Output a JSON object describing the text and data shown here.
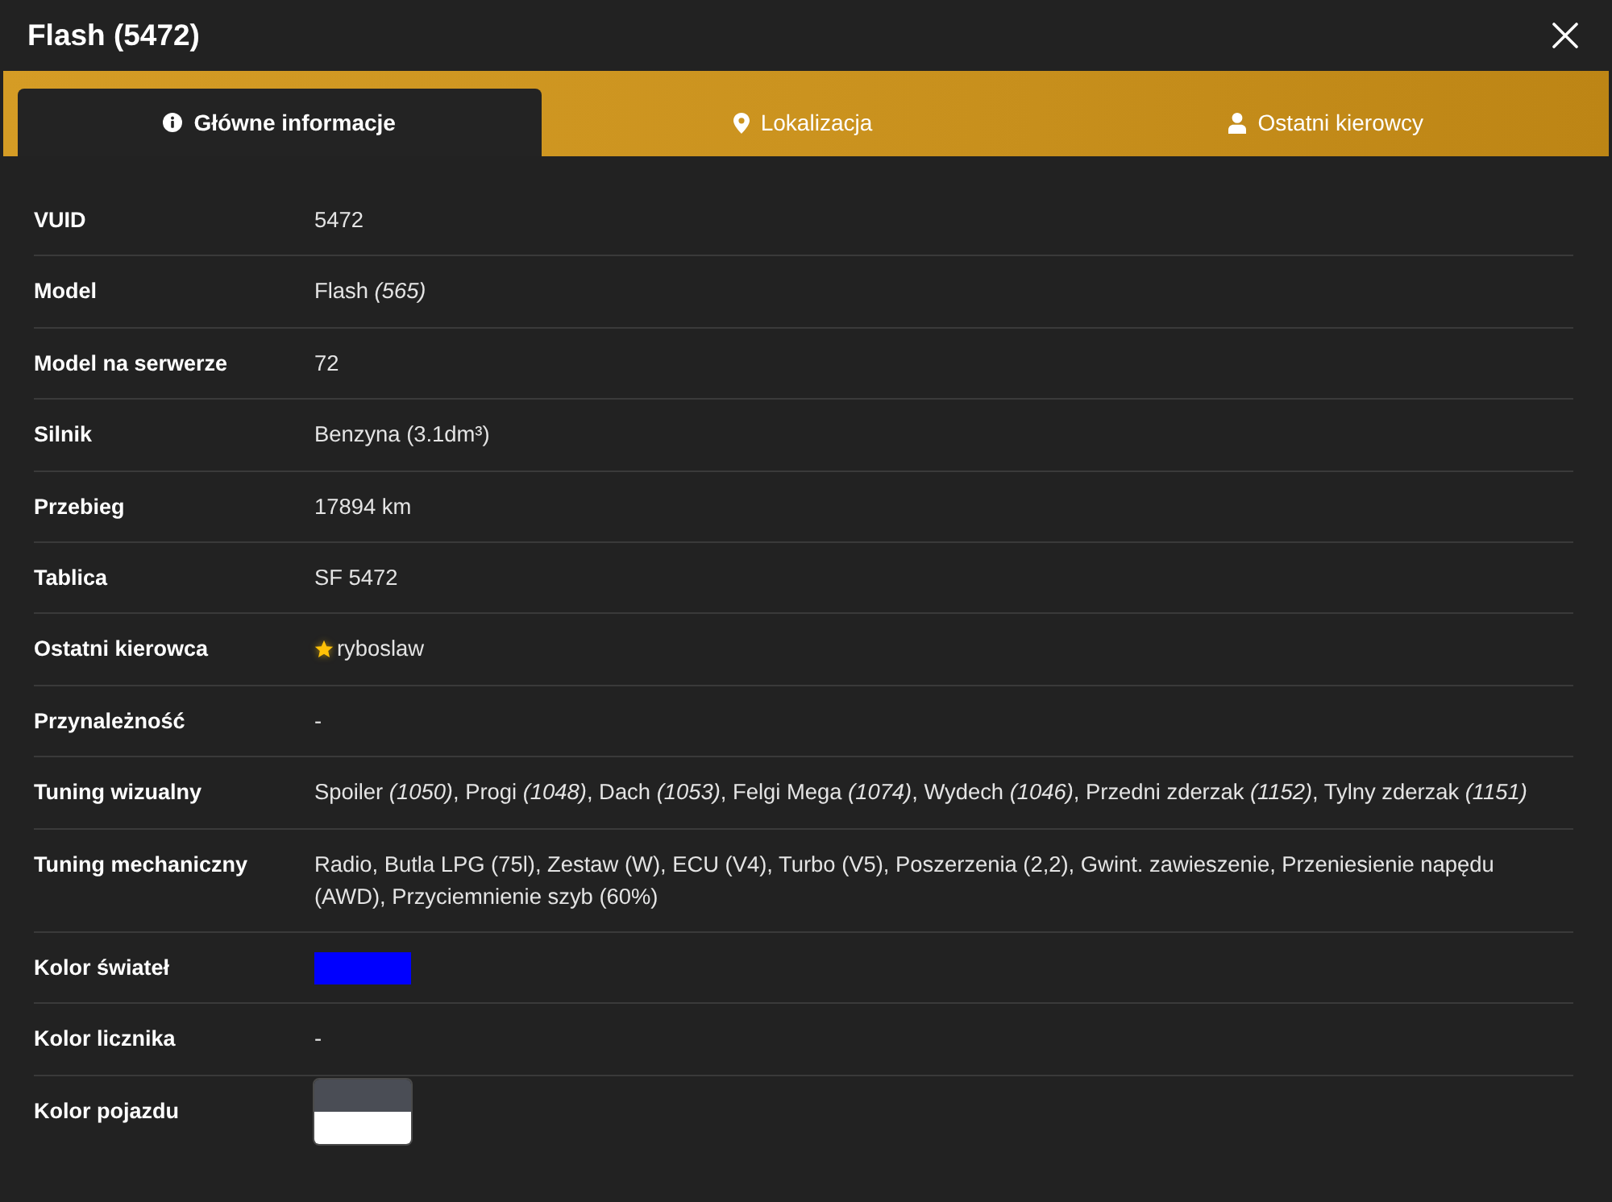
{
  "window": {
    "title": "Flash (5472)"
  },
  "tabs": [
    {
      "label": "Główne informacje",
      "kind": "info",
      "selected": true
    },
    {
      "label": "Lokalizacja",
      "kind": "location",
      "selected": false
    },
    {
      "label": "Ostatni kierowcy",
      "kind": "person",
      "selected": false
    }
  ],
  "rows": [
    {
      "label": "VUID",
      "kind": "text",
      "value": "5472"
    },
    {
      "label": "Model",
      "kind": "text",
      "value": "Flash *(565)*"
    },
    {
      "label": "Model na serwerze",
      "kind": "text",
      "value": "72"
    },
    {
      "label": "Silnik",
      "kind": "text",
      "value": "Benzyna (3.1dm³)"
    },
    {
      "label": "Przebieg",
      "kind": "text",
      "value": "17894 km"
    },
    {
      "label": "Tablica",
      "kind": "text",
      "value": "SF 5472"
    },
    {
      "label": "Ostatni kierowca",
      "kind": "player",
      "value": "ryboslaw"
    },
    {
      "label": "Przynależność",
      "kind": "text",
      "value": "-"
    },
    {
      "label": "Tuning wizualny",
      "kind": "text",
      "value": "Spoiler *(1050)*, Progi *(1048)*, Dach *(1053)*, Felgi Mega *(1074)*, Wydech *(1046)*, Przedni zderzak *(1152)*, Tylny zderzak *(1151)*"
    },
    {
      "label": "Tuning mechaniczny",
      "kind": "text",
      "value": "Radio, Butla LPG (75l), Zestaw (W), ECU (V4), Turbo (V5), Poszerzenia (2,2), Gwint. zawieszenie, Przeniesienie napędu (AWD), Przyciemnienie szyb (60%)"
    },
    {
      "label": "Kolor świateł",
      "kind": "colors",
      "colors": [
        {
          "color": "#0000ff"
        }
      ]
    },
    {
      "label": "Kolor licznika",
      "kind": "text",
      "value": "-"
    },
    {
      "label": "Kolor pojazdu",
      "kind": "colors",
      "colors": [
        {
          "color": "#4a4d55"
        },
        {
          "color": "#ffffff"
        }
      ]
    }
  ]
}
